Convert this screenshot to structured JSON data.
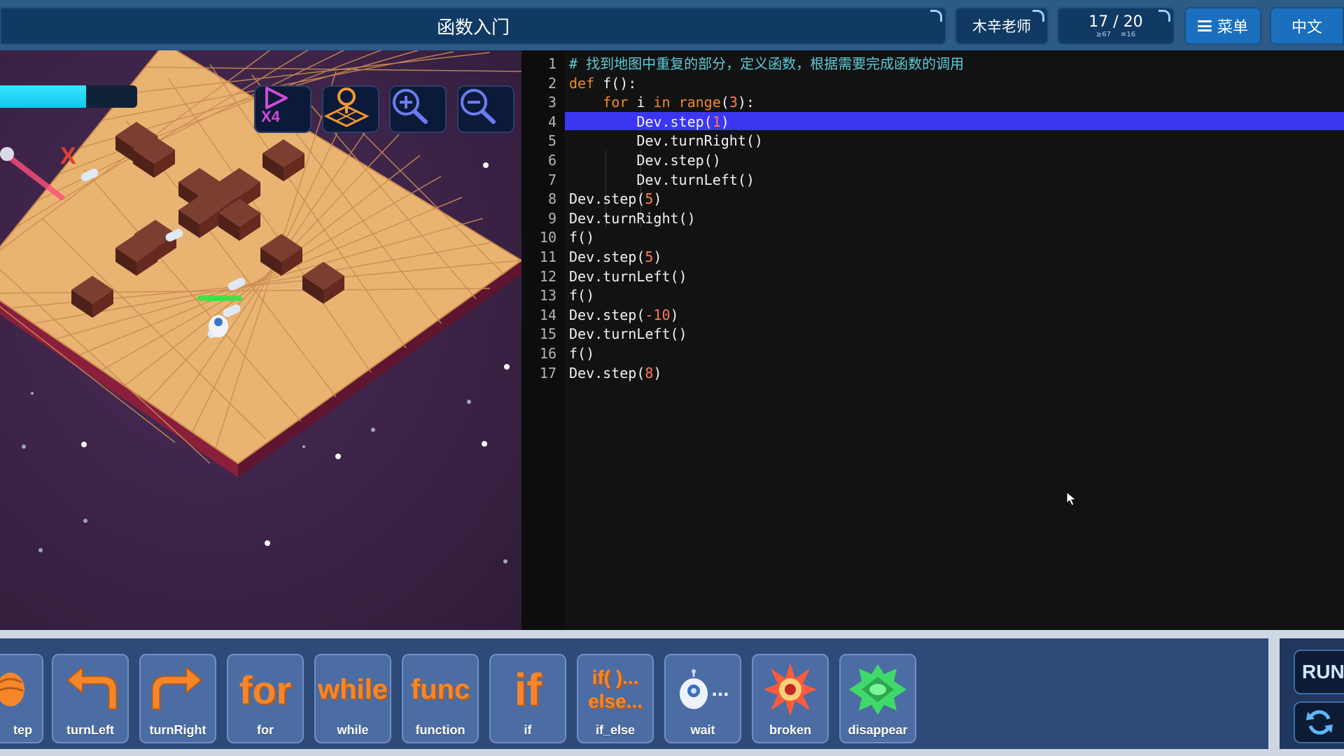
{
  "header": {
    "level_title": "函数入门",
    "teacher": "木辛老师",
    "progress": "17 / 20",
    "progress_sub_left": "≥67",
    "progress_sub_right": "≡16",
    "menu_label": "菜单",
    "language_label": "中文"
  },
  "game": {
    "energy_fraction": 0.63,
    "marker_text": "X",
    "speed_button_text": "X4",
    "buttons": [
      "speed-x4-icon",
      "map-view-icon",
      "zoom-in-icon",
      "zoom-out-icon"
    ]
  },
  "editor": {
    "line_numbers": [
      "1",
      "2",
      "3",
      "4",
      "5",
      "6",
      "7",
      "8",
      "9",
      "10",
      "11",
      "12",
      "13",
      "14",
      "15",
      "16",
      "17"
    ],
    "highlighted_line": 4,
    "lines": [
      "# 找到地图中重复的部分，定义函数，根据需要完成函数的调用",
      "def f():",
      "    for i in range(3):",
      "        Dev.step(1)",
      "        Dev.turnRight()",
      "        Dev.step()",
      "        Dev.turnLeft()",
      "Dev.step(5)",
      "Dev.turnRight()",
      "f()",
      "Dev.step(5)",
      "Dev.turnLeft()",
      "f()",
      "Dev.step(-10)",
      "Dev.turnLeft()",
      "f()",
      "Dev.step(8)"
    ]
  },
  "blocks": {
    "items": [
      {
        "label": "tep",
        "icon": "step-icon"
      },
      {
        "label": "turnLeft",
        "icon": "turn-left-arrow-icon"
      },
      {
        "label": "turnRight",
        "icon": "turn-right-arrow-icon"
      },
      {
        "label": "for",
        "icon_text": "for"
      },
      {
        "label": "while",
        "icon_text": "while"
      },
      {
        "label": "function",
        "icon_text": "func"
      },
      {
        "label": "if",
        "icon_text": "if"
      },
      {
        "label": "if_else",
        "icon_text_1": "if( )...",
        "icon_text_2": "else..."
      },
      {
        "label": "wait",
        "icon": "robot-wait-icon",
        "icon_text": "..."
      },
      {
        "label": "broken",
        "icon": "explosion-icon"
      },
      {
        "label": "disappear",
        "icon": "disappear-tile-icon"
      }
    ]
  },
  "controls": {
    "run_label": "RUN",
    "reset_icon": "refresh-icon"
  },
  "colors": {
    "topbar": "#2d5a86",
    "editor_bg": "#121212",
    "highlight": "#3a36f2",
    "keyword": "#f08a2a",
    "number": "#ff7a52",
    "comment": "#5ecad6",
    "block_orange": "#f5862a"
  }
}
